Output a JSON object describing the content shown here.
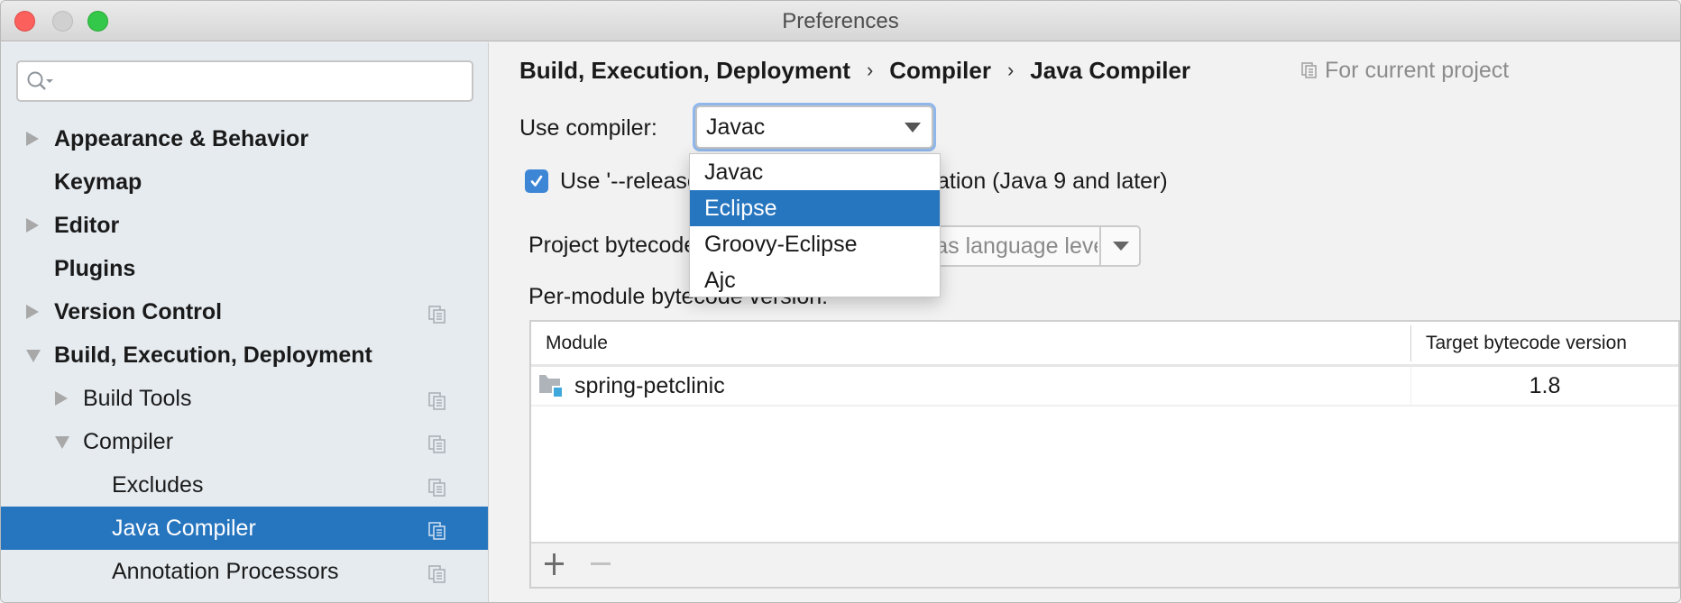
{
  "window": {
    "title": "Preferences"
  },
  "sidebar": {
    "search": {
      "value": "",
      "placeholder": ""
    },
    "items": [
      {
        "label": "Appearance & Behavior",
        "level": 0,
        "expander": "collapsed",
        "bold": true,
        "project_icon": false,
        "selected": false
      },
      {
        "label": "Keymap",
        "level": 0,
        "expander": "none",
        "bold": true,
        "project_icon": false,
        "selected": false
      },
      {
        "label": "Editor",
        "level": 0,
        "expander": "collapsed",
        "bold": true,
        "project_icon": false,
        "selected": false
      },
      {
        "label": "Plugins",
        "level": 0,
        "expander": "none",
        "bold": true,
        "project_icon": false,
        "selected": false
      },
      {
        "label": "Version Control",
        "level": 0,
        "expander": "collapsed",
        "bold": true,
        "project_icon": true,
        "selected": false
      },
      {
        "label": "Build, Execution, Deployment",
        "level": 0,
        "expander": "expanded",
        "bold": true,
        "project_icon": false,
        "selected": false
      },
      {
        "label": "Build Tools",
        "level": 1,
        "expander": "collapsed",
        "bold": false,
        "project_icon": true,
        "selected": false
      },
      {
        "label": "Compiler",
        "level": 1,
        "expander": "expanded",
        "bold": false,
        "project_icon": true,
        "selected": false
      },
      {
        "label": "Excludes",
        "level": 2,
        "expander": "none",
        "bold": false,
        "project_icon": true,
        "selected": false
      },
      {
        "label": "Java Compiler",
        "level": 2,
        "expander": "none",
        "bold": false,
        "project_icon": true,
        "selected": true
      },
      {
        "label": "Annotation Processors",
        "level": 2,
        "expander": "none",
        "bold": false,
        "project_icon": true,
        "selected": false
      }
    ]
  },
  "main": {
    "breadcrumb": [
      "Build, Execution, Deployment",
      "Compiler",
      "Java Compiler"
    ],
    "breadcrumb_separator": "›",
    "scope_label": "For current project",
    "use_compiler": {
      "label": "Use compiler:",
      "value": "Javac",
      "options": [
        "Javac",
        "Eclipse",
        "Groovy-Eclipse",
        "Ajc"
      ],
      "highlighted_option": "Eclipse"
    },
    "release_option": {
      "label": "Use '--release' option for cross-compilation (Java 9 and later)",
      "checked": true
    },
    "project_bytecode": {
      "label": "Project bytecode version:",
      "placeholder": "Same as language level"
    },
    "per_module": {
      "label": "Per-module bytecode version:",
      "columns": [
        "Module",
        "Target bytecode version"
      ],
      "rows": [
        {
          "module": "spring-petclinic",
          "version": "1.8"
        }
      ],
      "toolbar": {
        "add": "+",
        "remove": "−"
      }
    }
  },
  "colors": {
    "selection": "#2675bf",
    "sidebar_bg": "#e6ebf0",
    "focus_ring": "#8fb7ec",
    "checkbox": "#3d86d6"
  }
}
